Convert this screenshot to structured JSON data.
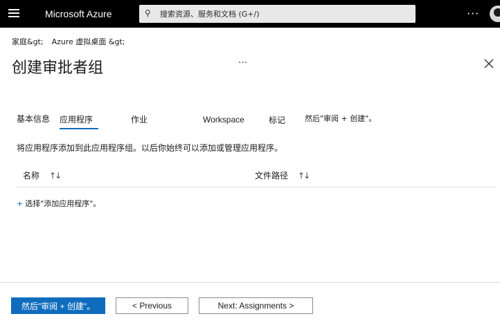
{
  "topbar": {
    "brand": "Microsoft Azure",
    "search_placeholder": "搜索资源、服务和文档 (G+/)",
    "more_label": "···"
  },
  "breadcrumb": {
    "items": [
      "家庭&gt;",
      "Azure 虚拟桌面 &gt;"
    ]
  },
  "page": {
    "title": "创建审批者组",
    "more_label": "···"
  },
  "tabs": [
    {
      "label": "基本信息",
      "active": false
    },
    {
      "label": "应用程序",
      "active": true
    },
    {
      "label": "作业",
      "active": false
    },
    {
      "label": "Workspace",
      "active": false
    },
    {
      "label": "标记",
      "active": false
    },
    {
      "label": "然后\"审阅 + 创建\"。",
      "active": false
    }
  ],
  "main": {
    "description": "将应用程序添加到此应用程序组。以后你始终可以添加或管理应用程序。",
    "table": {
      "columns": [
        "名称",
        "文件路径"
      ],
      "rows": []
    },
    "add_link": "选择\"添加应用程序\"。"
  },
  "footer": {
    "review_create": "然后\"审阅 + 创建\"。",
    "previous": "< Previous",
    "next": "Next: Assignments >"
  },
  "colors": {
    "accent": "#0f6cbd",
    "topbar_bg": "#000000"
  }
}
